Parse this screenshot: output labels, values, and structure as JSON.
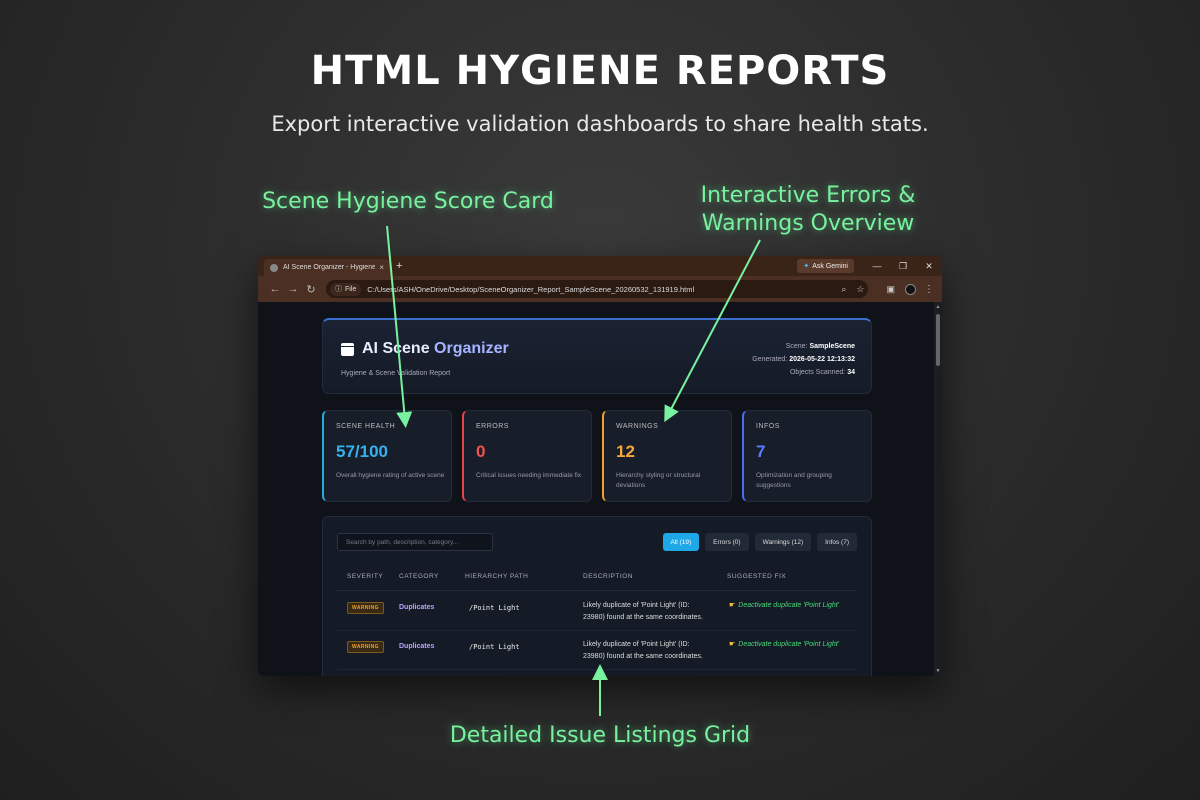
{
  "hero": {
    "title": "HTML HYGIENE REPORTS",
    "subtitle": "Export interactive validation dashboards to share health stats."
  },
  "callouts": {
    "score_card": "Scene Hygiene Score Card",
    "errors_line1": "Interactive Errors &",
    "errors_line2": "Warnings Overview",
    "grid": "Detailed Issue Listings Grid"
  },
  "browser": {
    "tab_title": "AI Scene Organizer - Hygiene Rep",
    "tab_close": "×",
    "new_tab": "+",
    "ask_gemini": "Ask Gemini",
    "file_chip": "File",
    "url": "C:/Users/ASH/OneDrive/Desktop/SceneOrganizer_Report_SampleScene_20260532_131919.html",
    "icons": [
      "back-icon",
      "forward-icon",
      "reload-icon",
      "zoom-icon",
      "star-icon",
      "sidepanel-icon",
      "profile-icon",
      "menu-icon"
    ]
  },
  "report": {
    "brand_prefix": "AI Scene ",
    "brand_highlight": "Organizer",
    "tagline": "Hygiene & Scene Validation Report",
    "scene_label": "Scene:",
    "scene_value": "SampleScene",
    "generated_label": "Generated:",
    "generated_value": "2026-05-22 12:13:32",
    "objects_label": "Objects Scanned:",
    "objects_value": "34"
  },
  "stats": {
    "health": {
      "label": "SCENE HEALTH",
      "value": "57/100",
      "desc": "Overall hygiene rating of active scene"
    },
    "errors": {
      "label": "ERRORS",
      "value": "0",
      "desc": "Critical issues needing immediate fix"
    },
    "warnings": {
      "label": "WARNINGS",
      "value": "12",
      "desc1": "Hierarchy styling or structural",
      "desc2": "deviations"
    },
    "infos": {
      "label": "INFOS",
      "value": "7",
      "desc1": "Optimization and grouping",
      "desc2": "suggestions"
    }
  },
  "colors": {
    "health": "#35b3f0",
    "errors": "#ef5353",
    "warnings": "#f5a83a",
    "infos": "#5c7cff",
    "callout": "#79f2a0"
  },
  "table": {
    "search_placeholder": "Search by path, description, category...",
    "filters": [
      "All (19)",
      "Errors (0)",
      "Warnings (12)",
      "Infos (7)"
    ],
    "columns": [
      "SEVERITY",
      "CATEGORY",
      "HIERARCHY PATH",
      "DESCRIPTION",
      "SUGGESTED FIX"
    ],
    "rows": [
      {
        "severity": "WARNING",
        "category": "Duplicates",
        "path": "/Point Light",
        "desc1": "Likely duplicate of 'Point Light' (ID:",
        "desc2": "23980) found at the same coordinates.",
        "fix": "Deactivate duplicate 'Point Light'"
      },
      {
        "severity": "WARNING",
        "category": "Duplicates",
        "path": "/Point Light",
        "desc1": "Likely duplicate of 'Point Light' (ID:",
        "desc2": "23980) found at the same coordinates.",
        "fix": "Deactivate duplicate 'Point Light'"
      }
    ]
  }
}
